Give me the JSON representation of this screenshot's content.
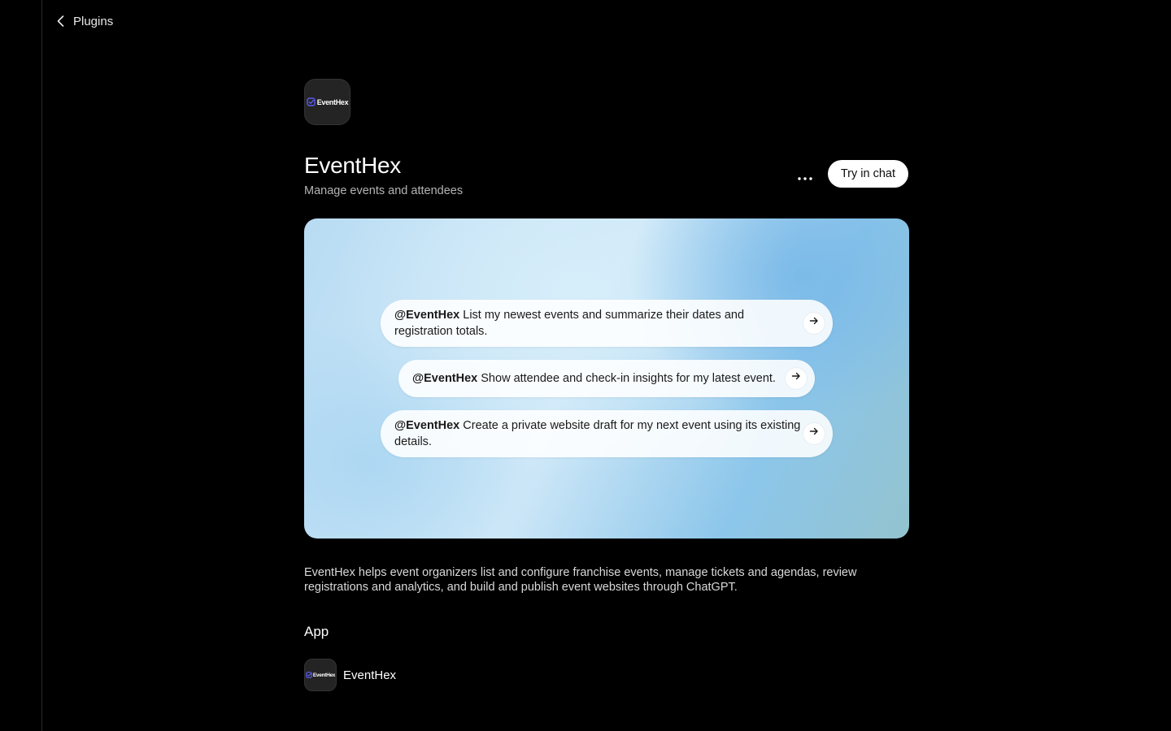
{
  "nav": {
    "back_label": "Plugins"
  },
  "app": {
    "logo_text": "EventHex",
    "title": "EventHex",
    "subtitle": "Manage events and attendees",
    "more_icon": "ellipsis-icon",
    "try_button_label": "Try in chat"
  },
  "prompts": [
    {
      "mention": "@EventHex",
      "text": " List my newest events and summarize their dates and registration totals."
    },
    {
      "mention": "@EventHex",
      "text": " Show attendee and check-in insights for my latest event."
    },
    {
      "mention": "@EventHex",
      "text": " Create a private website draft for my next event using its existing details."
    }
  ],
  "description": "EventHex helps event organizers list and configure franchise events, manage tickets and agendas, review registrations and analytics, and build and publish event websites through ChatGPT.",
  "apps_section": {
    "title": "App",
    "items": [
      {
        "logo_text": "EventHex",
        "name": "EventHex"
      }
    ]
  },
  "colors": {
    "background": "#000000",
    "logo_check": "#5b5bf0",
    "button_bg": "#ffffff"
  }
}
